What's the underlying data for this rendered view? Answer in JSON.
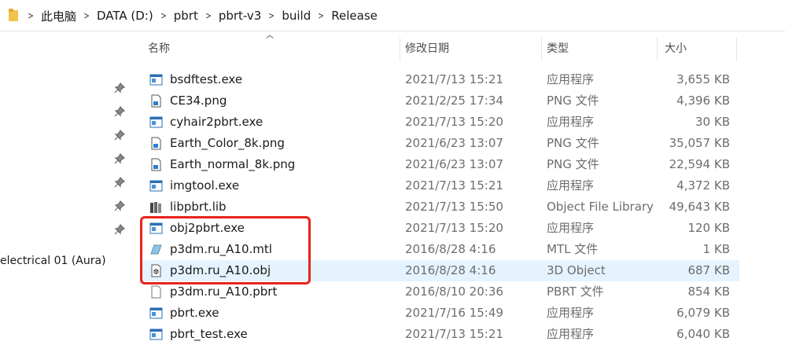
{
  "breadcrumb": [
    "此电脑",
    "DATA (D:)",
    "pbrt",
    "pbrt-v3",
    "build",
    "Release"
  ],
  "columns": {
    "name": "名称",
    "date": "修改日期",
    "type": "类型",
    "size": "大小"
  },
  "nav": {
    "pinned_label": "electrical 01 (Aura)"
  },
  "files": [
    {
      "name": "bsdftest.exe",
      "date": "2021/7/13 15:21",
      "type": "应用程序",
      "size": "3,655 KB",
      "icon": "exe-icon"
    },
    {
      "name": "CE34.png",
      "date": "2021/2/25 17:34",
      "type": "PNG 文件",
      "size": "4,396 KB",
      "icon": "png-file-icon"
    },
    {
      "name": "cyhair2pbrt.exe",
      "date": "2021/7/13 15:20",
      "type": "应用程序",
      "size": "30 KB",
      "icon": "exe-icon"
    },
    {
      "name": "Earth_Color_8k.png",
      "date": "2021/6/23 13:07",
      "type": "PNG 文件",
      "size": "35,057 KB",
      "icon": "png-file-icon"
    },
    {
      "name": "Earth_normal_8k.png",
      "date": "2021/6/23 13:07",
      "type": "PNG 文件",
      "size": "22,594 KB",
      "icon": "png-file-icon"
    },
    {
      "name": "imgtool.exe",
      "date": "2021/7/13 15:21",
      "type": "应用程序",
      "size": "4,372 KB",
      "icon": "exe-icon"
    },
    {
      "name": "libpbrt.lib",
      "date": "2021/7/13 15:50",
      "type": "Object File Library",
      "size": "49,643 KB",
      "icon": "library-icon"
    },
    {
      "name": "obj2pbrt.exe",
      "date": "2021/7/13 15:20",
      "type": "应用程序",
      "size": "120 KB",
      "icon": "exe-icon"
    },
    {
      "name": "p3dm.ru_A10.mtl",
      "date": "2016/8/28 4:16",
      "type": "MTL 文件",
      "size": "1 KB",
      "icon": "mtl-file-icon"
    },
    {
      "name": "p3dm.ru_A10.obj",
      "date": "2016/8/28 4:16",
      "type": "3D Object",
      "size": "687 KB",
      "icon": "3d-object-icon"
    },
    {
      "name": "p3dm.ru_A10.pbrt",
      "date": "2016/8/10 20:36",
      "type": "PBRT 文件",
      "size": "854 KB",
      "icon": "blank-file-icon"
    },
    {
      "name": "pbrt.exe",
      "date": "2021/7/16 15:49",
      "type": "应用程序",
      "size": "6,079 KB",
      "icon": "exe-icon"
    },
    {
      "name": "pbrt_test.exe",
      "date": "2021/7/13 15:21",
      "type": "应用程序",
      "size": "6,040 KB",
      "icon": "exe-icon"
    }
  ],
  "selected_row": "p3dm.ru_A10.obj",
  "colors": {
    "selection": "#e5f3ff",
    "annotation_box": "#e8231c",
    "folder": "#f3c24a"
  }
}
